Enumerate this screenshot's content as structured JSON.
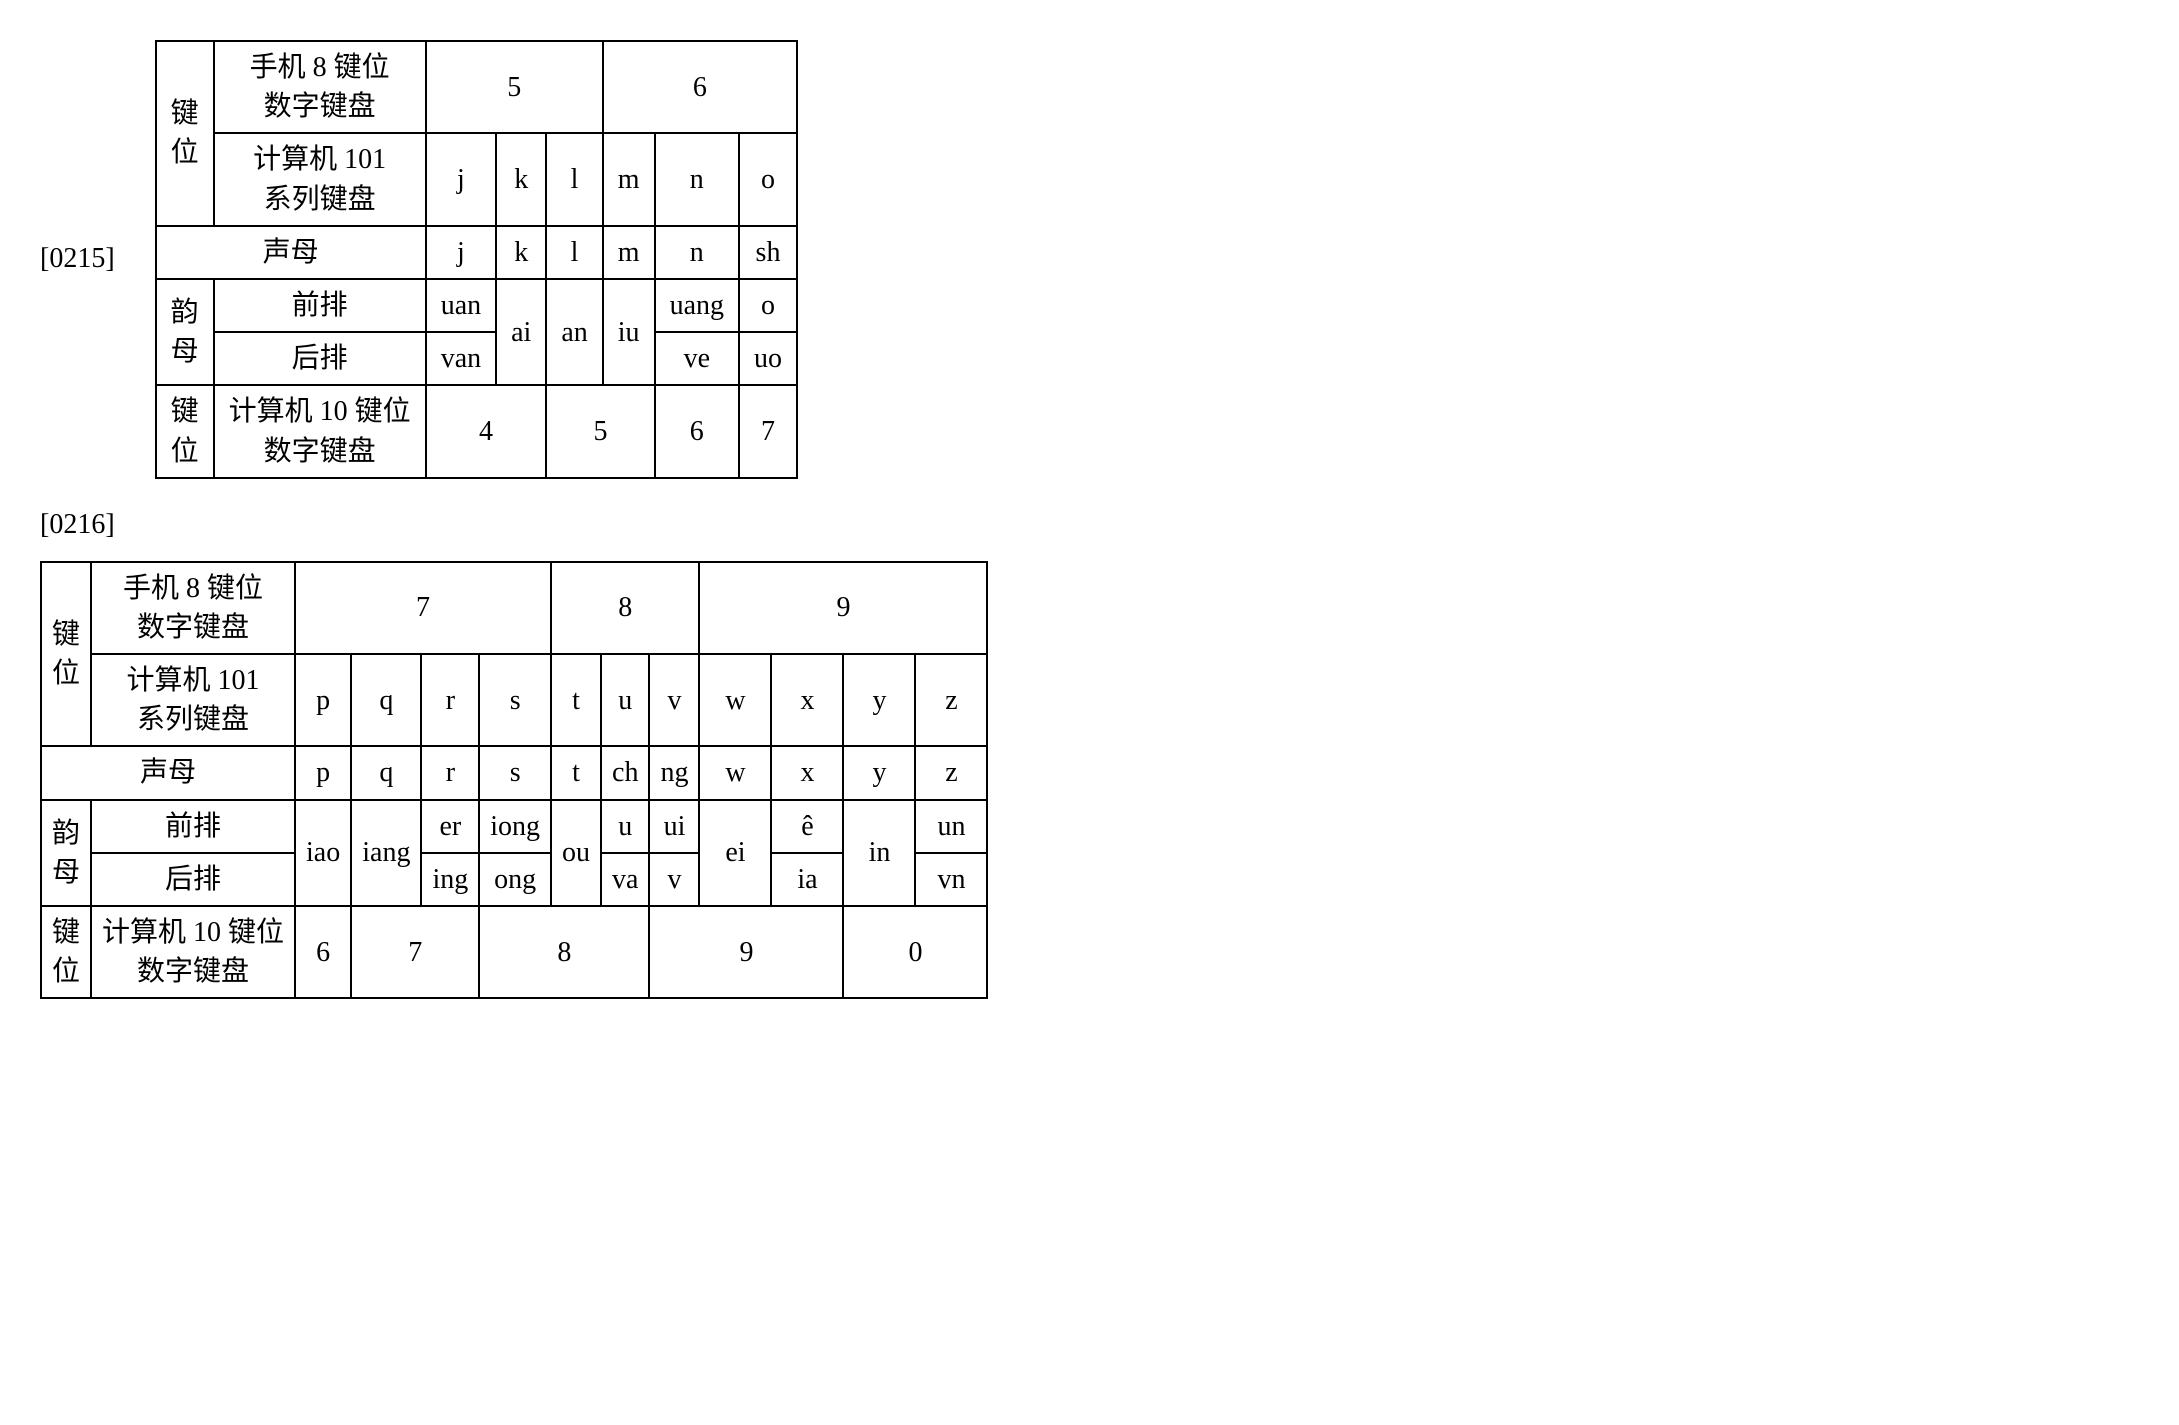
{
  "para1": "[0215]",
  "para2": "[0216]",
  "labels": {
    "key": "键",
    "pos": "位",
    "phone8": "手机 8 键位",
    "numpad": "数字键盘",
    "comp101": "计算机 101",
    "series": "系列键盘",
    "initial": "声母",
    "final": "韵",
    "mother": "母",
    "front": "前排",
    "back": "后排",
    "comp10": "计算机 10 键位"
  },
  "t1": {
    "h1": "5",
    "h2": "6",
    "j": "j",
    "k": "k",
    "l": "l",
    "m": "m",
    "n": "n",
    "o": "o",
    "sj": "j",
    "sk": "k",
    "sl": "l",
    "sm": "m",
    "sn": "n",
    "ssh": "sh",
    "uan": "uan",
    "ai": "ai",
    "an": "an",
    "iu": "iu",
    "uang": "uang",
    "fo": "o",
    "van": "van",
    "ve": "ve",
    "uo": "uo",
    "b4": "4",
    "b5": "5",
    "b6": "6",
    "b7": "7"
  },
  "t2": {
    "h7": "7",
    "h8": "8",
    "h9": "9",
    "p": "p",
    "q": "q",
    "r": "r",
    "s": "s",
    "t": "t",
    "u": "u",
    "v": "v",
    "w": "w",
    "x": "x",
    "y": "y",
    "z": "z",
    "sp": "p",
    "sq": "q",
    "sr": "r",
    "ss": "s",
    "st": "t",
    "sch": "ch",
    "sng": "ng",
    "sw": "w",
    "sx": "x",
    "sy": "y",
    "sz": "z",
    "iao": "iao",
    "iang": "iang",
    "er": "er",
    "iong": "iong",
    "ou": "ou",
    "fu": "u",
    "ui": "ui",
    "ei": "ei",
    "ehat": "ê",
    "in": "in",
    "un": "un",
    "ing": "ing",
    "ong": "ong",
    "va": "va",
    "bv": "v",
    "ia": "ia",
    "vn": "vn",
    "b6": "6",
    "b7": "7",
    "b8": "8",
    "b9": "9",
    "b0": "0"
  }
}
